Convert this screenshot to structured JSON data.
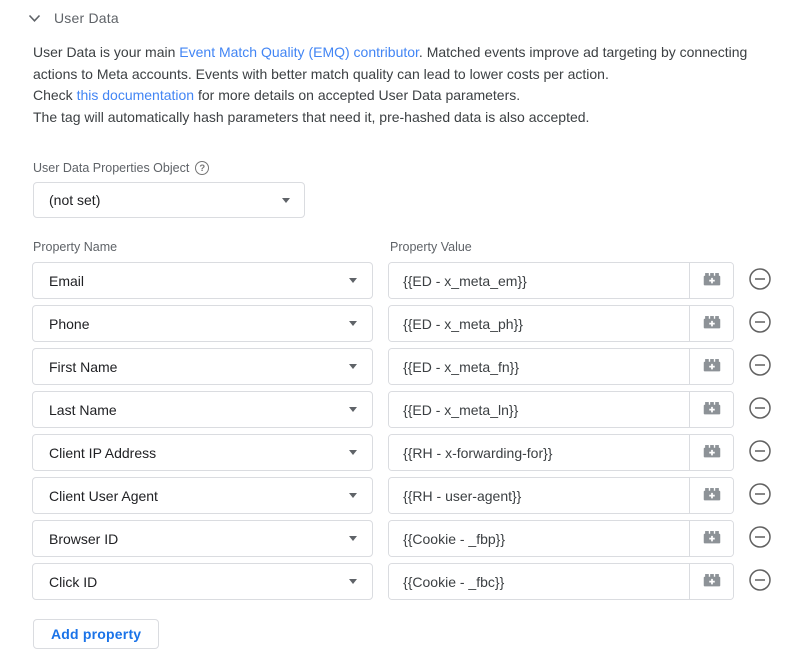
{
  "header": {
    "title": "User Data"
  },
  "description": {
    "p1_before": "User Data is your main ",
    "p1_link": "Event Match Quality (EMQ) contributor",
    "p1_after": ". Matched events improve ad targeting by connecting actions to Meta accounts. Events with better match quality can lead to lower costs per action.",
    "p2_before": "Check ",
    "p2_link": "this documentation",
    "p2_after": " for more details on accepted User Data parameters.",
    "p3": "The tag will automatically hash parameters that need it, pre-hashed data is also accepted."
  },
  "properties_object": {
    "label": "User Data Properties Object",
    "help_icon": "?",
    "value": "(not set)"
  },
  "table": {
    "name_header": "Property Name",
    "value_header": "Property Value",
    "rows": [
      {
        "name": "Email",
        "value": "{{ED - x_meta_em}}"
      },
      {
        "name": "Phone",
        "value": "{{ED - x_meta_ph}}"
      },
      {
        "name": "First Name",
        "value": "{{ED - x_meta_fn}}"
      },
      {
        "name": "Last Name",
        "value": "{{ED - x_meta_ln}}"
      },
      {
        "name": "Client IP Address",
        "value": "{{RH - x-forwarding-for}}"
      },
      {
        "name": "Client User Agent",
        "value": "{{RH - user-agent}}"
      },
      {
        "name": "Browser ID",
        "value": "{{Cookie - _fbp}}"
      },
      {
        "name": "Click ID",
        "value": "{{Cookie - _fbc}}"
      }
    ]
  },
  "add_button": {
    "label": "Add property"
  },
  "icons": {
    "collapse": "chevron-down",
    "help": "question-circle",
    "select_caret": "caret-down",
    "variable_picker": "brick-plus",
    "remove": "minus-circle"
  },
  "colors": {
    "link": "#4285f4",
    "accent": "#1a73e8",
    "border": "#dadce0",
    "label_gray": "#5f6368",
    "text": "#3c4043",
    "icon_gray": "#757575"
  }
}
